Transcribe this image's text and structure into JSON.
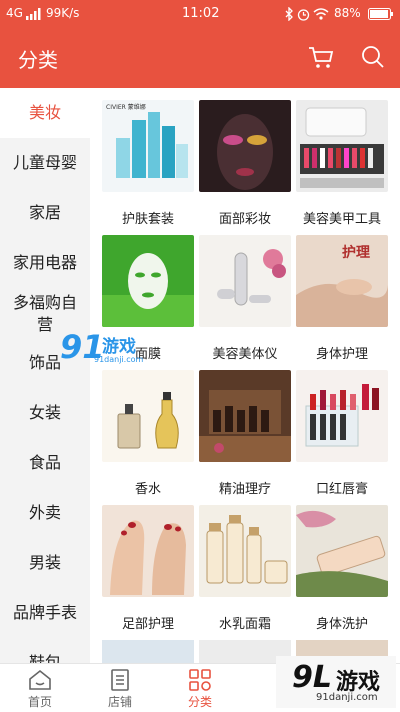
{
  "status": {
    "network": "4G",
    "speed": "99K/s",
    "time": "11:02",
    "battery": "88%"
  },
  "header": {
    "title": "分类"
  },
  "sidebar": {
    "items": [
      {
        "label": "美妆"
      },
      {
        "label": "儿童母婴"
      },
      {
        "label": "家居"
      },
      {
        "label": "家用电器"
      },
      {
        "label": "多福购自营"
      },
      {
        "label": "饰品"
      },
      {
        "label": "女装"
      },
      {
        "label": "食品"
      },
      {
        "label": "外卖"
      },
      {
        "label": "男装"
      },
      {
        "label": "品牌手表"
      },
      {
        "label": "鞋包"
      }
    ]
  },
  "grid": {
    "items": [
      {
        "label": "护肤套装"
      },
      {
        "label": "面部彩妆"
      },
      {
        "label": "美容美甲工具"
      },
      {
        "label": "面膜"
      },
      {
        "label": "美容美体仪"
      },
      {
        "label": "身体护理"
      },
      {
        "label": "香水"
      },
      {
        "label": "精油理疗"
      },
      {
        "label": "口红唇膏"
      },
      {
        "label": "足部护理"
      },
      {
        "label": "水乳面霜"
      },
      {
        "label": "身体洗护"
      }
    ]
  },
  "product_text": {
    "civier": "CIVIER 蒙维娜",
    "huli": "护理"
  },
  "tabs": [
    {
      "label": "首页"
    },
    {
      "label": "店铺"
    },
    {
      "label": "分类"
    }
  ],
  "watermark": {
    "mid_logo": "游戏",
    "mid_site": "91danji.com",
    "br_logo": "游戏",
    "br_site": "91danji.com"
  },
  "colors": {
    "accent": "#e8523f"
  }
}
